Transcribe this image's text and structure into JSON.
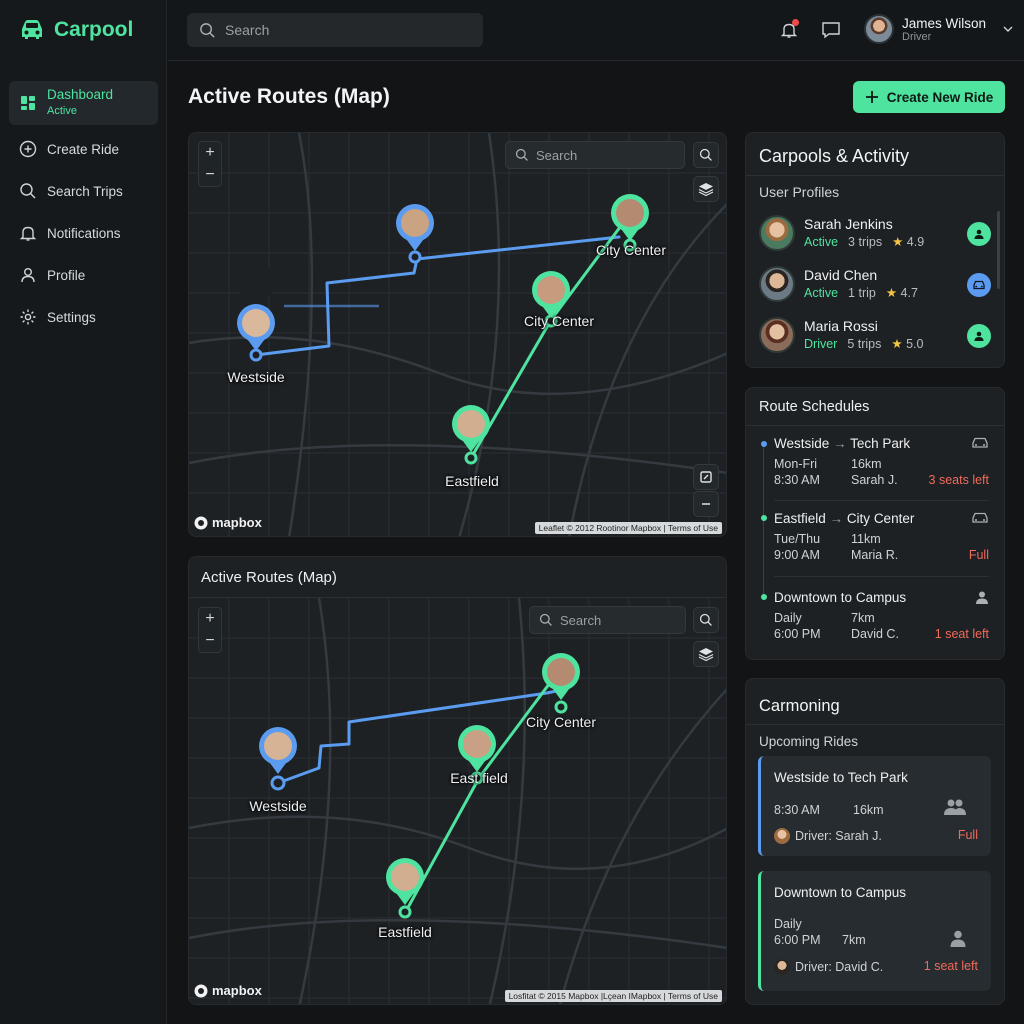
{
  "app": {
    "name": "Carpool",
    "accent": "#4fe3a0"
  },
  "sidebar": {
    "items": [
      {
        "label": "Dashboard",
        "sub": "Active",
        "icon": "dashboard-icon"
      },
      {
        "label": "Create Ride",
        "icon": "plus-circle-icon"
      },
      {
        "label": "Search Trips",
        "icon": "search-icon"
      },
      {
        "label": "Notifications",
        "icon": "bell-icon"
      },
      {
        "label": "Profile",
        "icon": "user-icon"
      },
      {
        "label": "Settings",
        "icon": "gear-icon"
      }
    ]
  },
  "topbar": {
    "search_placeholder": "Search",
    "user": {
      "name": "James Wilson",
      "role": "Driver"
    }
  },
  "page": {
    "title": "Active Routes (Map)",
    "create_label": "Create New Ride"
  },
  "map1": {
    "search_placeholder": "Search",
    "pins": {
      "westside": "Westside",
      "city_center_a": "City Center",
      "city_center_b": "City Center",
      "eastfield": "Eastfield"
    },
    "logo": "mapbox",
    "attribution": "Leaflet © 2012 Rootinor Mapbox | Terms of Use"
  },
  "map2": {
    "title": "Active Routes (Map)",
    "search_placeholder": "Search",
    "pins": {
      "westside": "Westside",
      "city_center": "City Center",
      "eastfield_mid": "East  field",
      "eastfield": "Eastfield"
    },
    "logo": "mapbox",
    "attribution": "Losfitat © 2015 Mapbox |Lçean IMapbox | Terms of Use"
  },
  "carpools": {
    "title": "Carpools & Activity",
    "subtitle": "User Profiles",
    "profiles": [
      {
        "name": "Sarah Jenkins",
        "status": "Active",
        "trips": "3 trips",
        "rating": "4.9",
        "action_color": "#4fe3a0"
      },
      {
        "name": "David Chen",
        "status": "Active",
        "trips": "1 trip",
        "rating": "4.7",
        "action_color": "#5b9cf0"
      },
      {
        "name": "Maria Rossi",
        "status": "Driver",
        "trips": "5 trips",
        "rating": "5.0",
        "action_color": "#4fe3a0"
      }
    ]
  },
  "schedules": {
    "title": "Route Schedules",
    "items": [
      {
        "from": "Westside",
        "arrow": "→",
        "to": "Tech Park",
        "days": "Mon-Fri",
        "time": "8:30 AM",
        "distance": "16km",
        "driver": "Sarah J.",
        "status": "3 seats left",
        "status_color": "#f06a5a",
        "dot": "#5b9cf0"
      },
      {
        "from": "Eastfield",
        "arrow": "→",
        "to": "City Center",
        "days": "Tue/Thu",
        "time": "9:00 AM",
        "distance": "11km",
        "driver": "Maria R.",
        "status": "Full",
        "status_color": "#f06a5a",
        "dot": "#4fe3a0"
      },
      {
        "from": "Downtown",
        "arrow": "to",
        "to": "Campus",
        "days": "Daily",
        "time": "6:00 PM",
        "distance": "7km",
        "driver": "David C.",
        "status": "1 seat left",
        "status_color": "#f06a5a",
        "dot": "#4fe3a0"
      }
    ]
  },
  "upcoming": {
    "title": "Carmoning",
    "subtitle": "Upcoming Rides",
    "rides": [
      {
        "title": "Westside to Tech Park",
        "time": "8:30 AM",
        "distance": "16km",
        "driver": "Driver: Sarah J.",
        "status": "Full"
      },
      {
        "title": "Downtown to Campus",
        "days": "Daily",
        "time": "6:00 PM",
        "distance": "7km",
        "driver": "Driver: David C.",
        "status": "1 seat left"
      }
    ]
  }
}
